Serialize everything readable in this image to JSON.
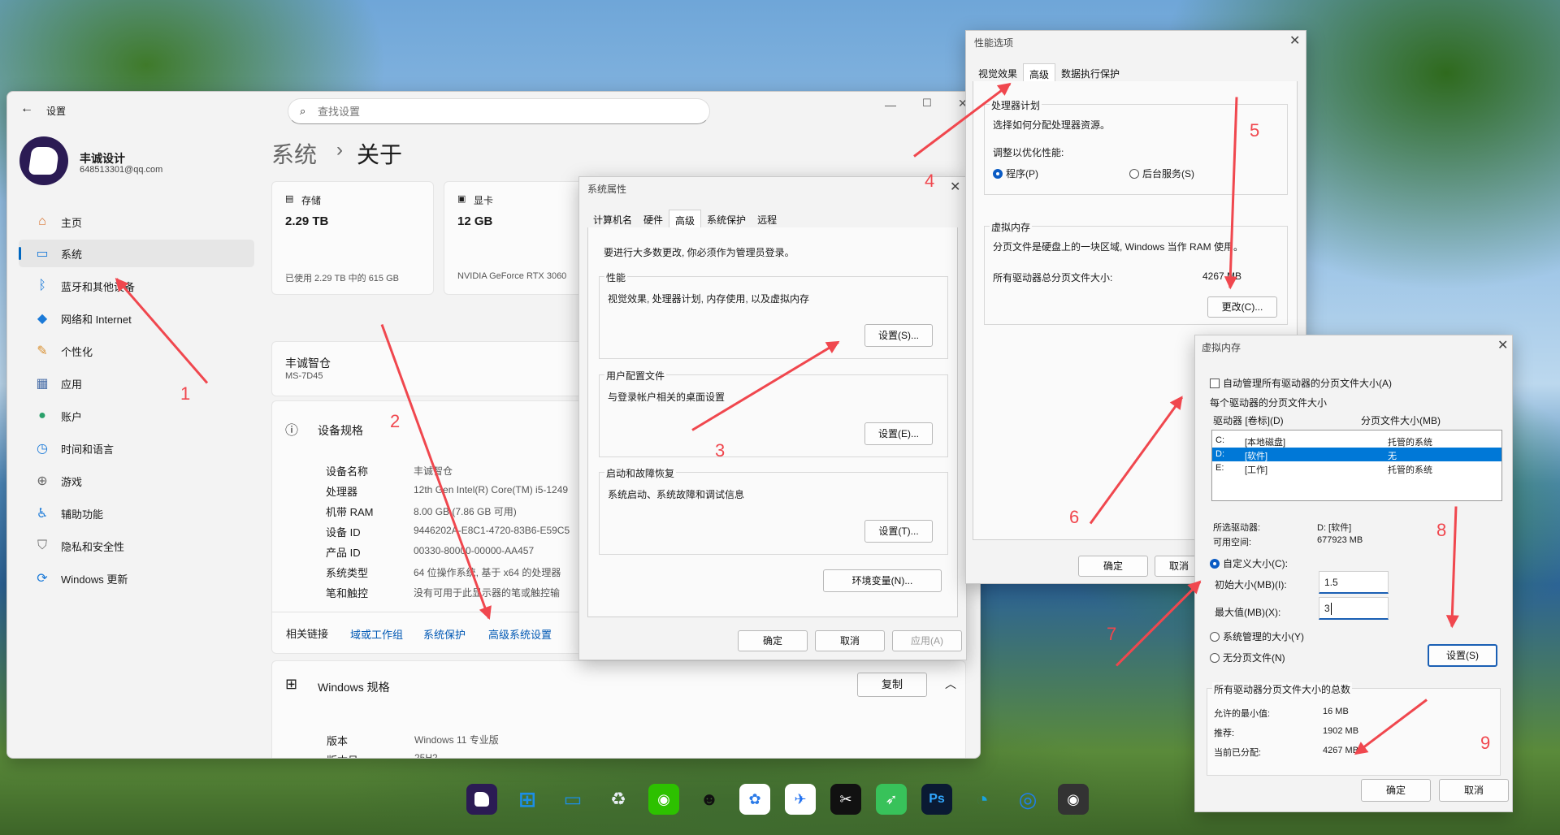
{
  "settings": {
    "title": "设置",
    "search_placeholder": "查找设置",
    "user_name": "丰诚设计",
    "user_email": "648513301@qq.com",
    "nav": [
      "主页",
      "系统",
      "蓝牙和其他设备",
      "网络和 Internet",
      "个性化",
      "应用",
      "账户",
      "时间和语言",
      "游戏",
      "辅助功能",
      "隐私和安全性",
      "Windows 更新"
    ],
    "breadcrumb_parent": "系统",
    "breadcrumb_sep": "›",
    "breadcrumb_current": "关于",
    "storage_label": "存储",
    "storage_value": "2.29 TB",
    "storage_detail": "已使用 2.29 TB 中的 615 GB",
    "gpu_label": "显卡",
    "gpu_value": "12 GB",
    "gpu_detail": "NVIDIA GeForce RTX 3060",
    "device_name_big": "丰诚智仓",
    "device_model": "MS-7D45",
    "spec_title": "设备规格",
    "specs": [
      {
        "k": "设备名称",
        "v": "丰诚智仓"
      },
      {
        "k": "处理器",
        "v": "12th Gen Intel(R) Core(TM) i5-1249"
      },
      {
        "k": "机带 RAM",
        "v": "8.00 GB (7.86 GB 可用)"
      },
      {
        "k": "设备 ID",
        "v": "9446202A-E8C1-4720-83B6-E59C5"
      },
      {
        "k": "产品 ID",
        "v": "00330-80000-00000-AA457"
      },
      {
        "k": "系统类型",
        "v": "64 位操作系统, 基于 x64 的处理器"
      },
      {
        "k": "笔和触控",
        "v": "没有可用于此显示器的笔或触控输"
      }
    ],
    "related_label": "相关链接",
    "links": [
      "域或工作组",
      "系统保护",
      "高级系统设置"
    ],
    "win_spec_title": "Windows 规格",
    "copy_btn": "复制",
    "win_specs": [
      {
        "k": "版本",
        "v": "Windows 11 专业版"
      },
      {
        "k": "版本号",
        "v": "25H2"
      }
    ]
  },
  "sysprops": {
    "title": "系统属性",
    "tabs": [
      "计算机名",
      "硬件",
      "高级",
      "系统保护",
      "远程"
    ],
    "admin_note": "要进行大多数更改, 你必须作为管理员登录。",
    "perf_title": "性能",
    "perf_desc": "视觉效果, 处理器计划, 内存使用, 以及虚拟内存",
    "perf_btn": "设置(S)...",
    "profile_title": "用户配置文件",
    "profile_desc": "与登录帐户相关的桌面设置",
    "profile_btn": "设置(E)...",
    "startup_title": "启动和故障恢复",
    "startup_desc": "系统启动、系统故障和调试信息",
    "startup_btn": "设置(T)...",
    "env_btn": "环境变量(N)...",
    "ok": "确定",
    "cancel": "取消",
    "apply": "应用(A)"
  },
  "perf": {
    "title": "性能选项",
    "tabs": [
      "视觉效果",
      "高级",
      "数据执行保护"
    ],
    "sched_title": "处理器计划",
    "sched_desc": "选择如何分配处理器资源。",
    "adjust_label": "调整以优化性能:",
    "programs": "程序(P)",
    "background": "后台服务(S)",
    "vm_title": "虚拟内存",
    "vm_desc": "分页文件是硬盘上的一块区域, Windows 当作 RAM 使用。",
    "total_label": "所有驱动器总分页文件大小:",
    "total_value": "4267 MB",
    "change_btn": "更改(C)...",
    "ok": "确定",
    "cancel": "取消"
  },
  "vm": {
    "title": "虚拟内存",
    "auto_label": "自动管理所有驱动器的分页文件大小(A)",
    "each_label": "每个驱动器的分页文件大小",
    "col_drive": "驱动器 [卷标](D)",
    "col_size": "分页文件大小(MB)",
    "drives": [
      {
        "letter": "C:",
        "label": "[本地磁盘]",
        "size": "托管的系统"
      },
      {
        "letter": "D:",
        "label": "[软件]",
        "size": "无"
      },
      {
        "letter": "E:",
        "label": "[工作]",
        "size": "托管的系统"
      }
    ],
    "sel_drive_label": "所选驱动器:",
    "sel_drive_value": "D: [软件]",
    "free_label": "可用空间:",
    "free_value": "677923 MB",
    "custom_label": "自定义大小(C):",
    "initial_label": "初始大小(MB)(I):",
    "initial_value": "1.5",
    "max_label": "最大值(MB)(X):",
    "max_value": "3",
    "system_managed": "系统管理的大小(Y)",
    "no_paging": "无分页文件(N)",
    "set_btn": "设置(S)",
    "totals_title": "所有驱动器分页文件大小的总数",
    "min_label": "允许的最小值:",
    "min_value": "16 MB",
    "rec_label": "推荐:",
    "rec_value": "1902 MB",
    "cur_label": "当前已分配:",
    "cur_value": "4267 MB",
    "ok": "确定",
    "cancel": "取消"
  },
  "annotations": [
    "1",
    "2",
    "3",
    "4",
    "5",
    "6",
    "7",
    "8",
    "9"
  ],
  "dock": [
    "PS-like",
    "Ps"
  ],
  "colors": {
    "accent": "#0067c0",
    "arrow": "#f0474e",
    "selection": "#0078d7"
  }
}
